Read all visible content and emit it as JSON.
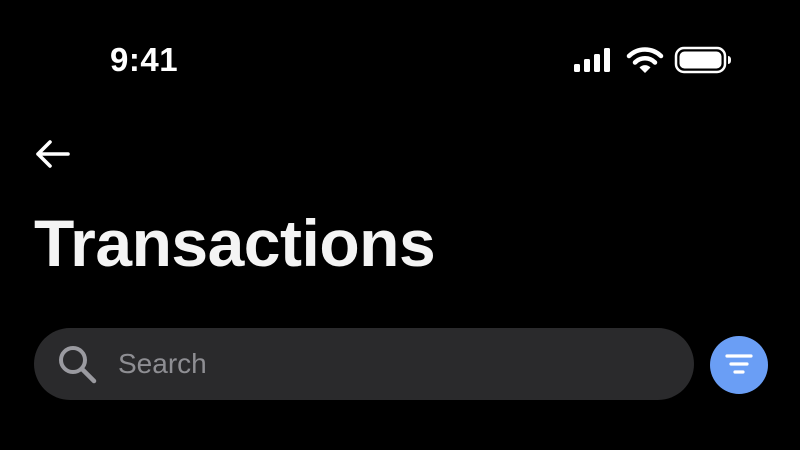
{
  "status_bar": {
    "time": "9:41",
    "icons": [
      "cellular-signal-icon",
      "wifi-icon",
      "battery-icon"
    ]
  },
  "header": {
    "back_icon": "arrow-left-icon",
    "title": "Transactions"
  },
  "search": {
    "placeholder": "Search",
    "value": "",
    "icon": "search-icon"
  },
  "filter": {
    "icon": "filter-icon"
  },
  "colors": {
    "background": "#000000",
    "search_field": "#2a2a2c",
    "placeholder": "#8e8e93",
    "filter_accent": "#6a9ef5",
    "text": "#ffffff"
  }
}
